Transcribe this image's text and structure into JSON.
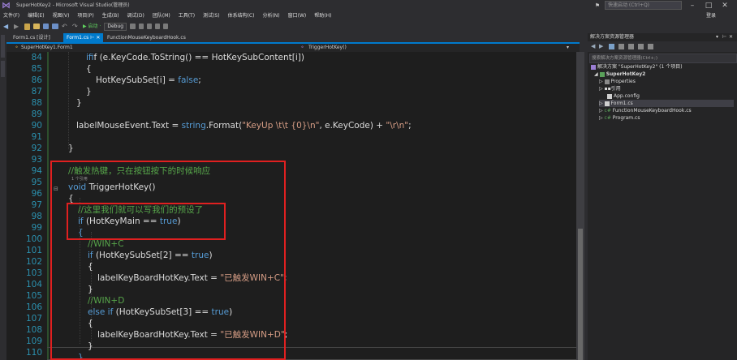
{
  "window": {
    "title": "SuperHotKey2 - Microsoft Visual Studio(管理员)",
    "quick_launch_placeholder": "快速启动 (Ctrl+Q)",
    "login": "登录"
  },
  "menu": [
    "文件(F)",
    "编辑(E)",
    "视图(V)",
    "项目(P)",
    "生成(B)",
    "调试(D)",
    "团队(M)",
    "工具(T)",
    "测试(S)",
    "体系结构(C)",
    "分析(N)",
    "窗口(W)",
    "帮助(H)"
  ],
  "toolbar": {
    "start_label": "▶ 启动 ·",
    "config": "Debug"
  },
  "tabs": [
    {
      "label": "Form1.cs [设计]",
      "active": false
    },
    {
      "label": "Form1.cs",
      "active": true
    },
    {
      "label": "FunctionMouseKeyboardHook.cs",
      "active": false
    }
  ],
  "nav": {
    "class_path": "SuperHotKey1.Form1",
    "member": "TriggerHotKey()"
  },
  "line_numbers": [
    "84",
    "85",
    "86",
    "87",
    "88",
    "89",
    "90",
    "91",
    "92",
    "93",
    "94",
    "95",
    "96",
    "97",
    "98",
    "99",
    "100",
    "101",
    "102",
    "103",
    "104",
    "105",
    "106",
    "107",
    "108",
    "109",
    "110",
    "111"
  ],
  "code": {
    "l84_a": "if (e.KeyCode.ToString() == HotKeySubContent[i])",
    "l86_a": "{",
    "l87_a": "HotKeySubSet[i] = ",
    "l87_b": "false",
    "l87_c": ";",
    "l88_a": "}",
    "l89_a": "}",
    "l91_a": "labelMouseEvent.Text = ",
    "l91_b": "string",
    "l91_c": ".Format(",
    "l91_d": "\"KeyUp \\t\\t {0}\\n\"",
    "l91_e": ", e.KeyCode) + ",
    "l91_f": "\"\\r\\n\"",
    "l91_g": ";",
    "l93_a": "}",
    "l95_a": "//触发热键，只在按钮按下的时候响应",
    "l95_ref": "1 个引用",
    "l96_a": "void",
    "l96_b": " TriggerHotKey()",
    "l97_a": "{",
    "l98_a": "//这里我们就可以写我们的预设了",
    "l99_a": "if",
    "l99_b": " (HotKeyMain == ",
    "l99_c": "true",
    "l99_d": ")",
    "l100_a": "{",
    "l101_a": "//WIN+C",
    "l102_a": "if",
    "l102_b": " (HotKeySubSet[2] == ",
    "l102_c": "true",
    "l102_d": ")",
    "l103_a": "{",
    "l104_a": "labelKeyBoardHotKey.Text = ",
    "l104_b": "\"已触发WIN+C\"",
    "l104_c": ";",
    "l105_a": "}",
    "l106_a": "//WIN+D",
    "l107_a": "else if",
    "l107_b": " (HotKeySubSet[3] == ",
    "l107_c": "true",
    "l107_d": ")",
    "l108_a": "{",
    "l109_a": "labelKeyBoardHotKey.Text = ",
    "l109_b": "\"已触发WIN+D\"",
    "l109_c": ";",
    "l110_a": "}",
    "l111_a": "}"
  },
  "solution": {
    "title": "解决方案资源管理器",
    "search_placeholder": "搜索解决方案资源管理器(Ctrl+;)",
    "root": "解决方案 \"SuperHotKey2\" (1 个项目)",
    "project": "SuperHotKey2",
    "items": [
      "Properties",
      "引用",
      "App.config",
      "Form1.cs",
      "FunctionMouseKeyboardHook.cs",
      "Program.cs"
    ]
  },
  "colors": {
    "accent": "#007acc",
    "keyword": "#569cd6",
    "comment": "#57a64a",
    "string": "#d69d85",
    "highlight_box": "#e02020"
  }
}
